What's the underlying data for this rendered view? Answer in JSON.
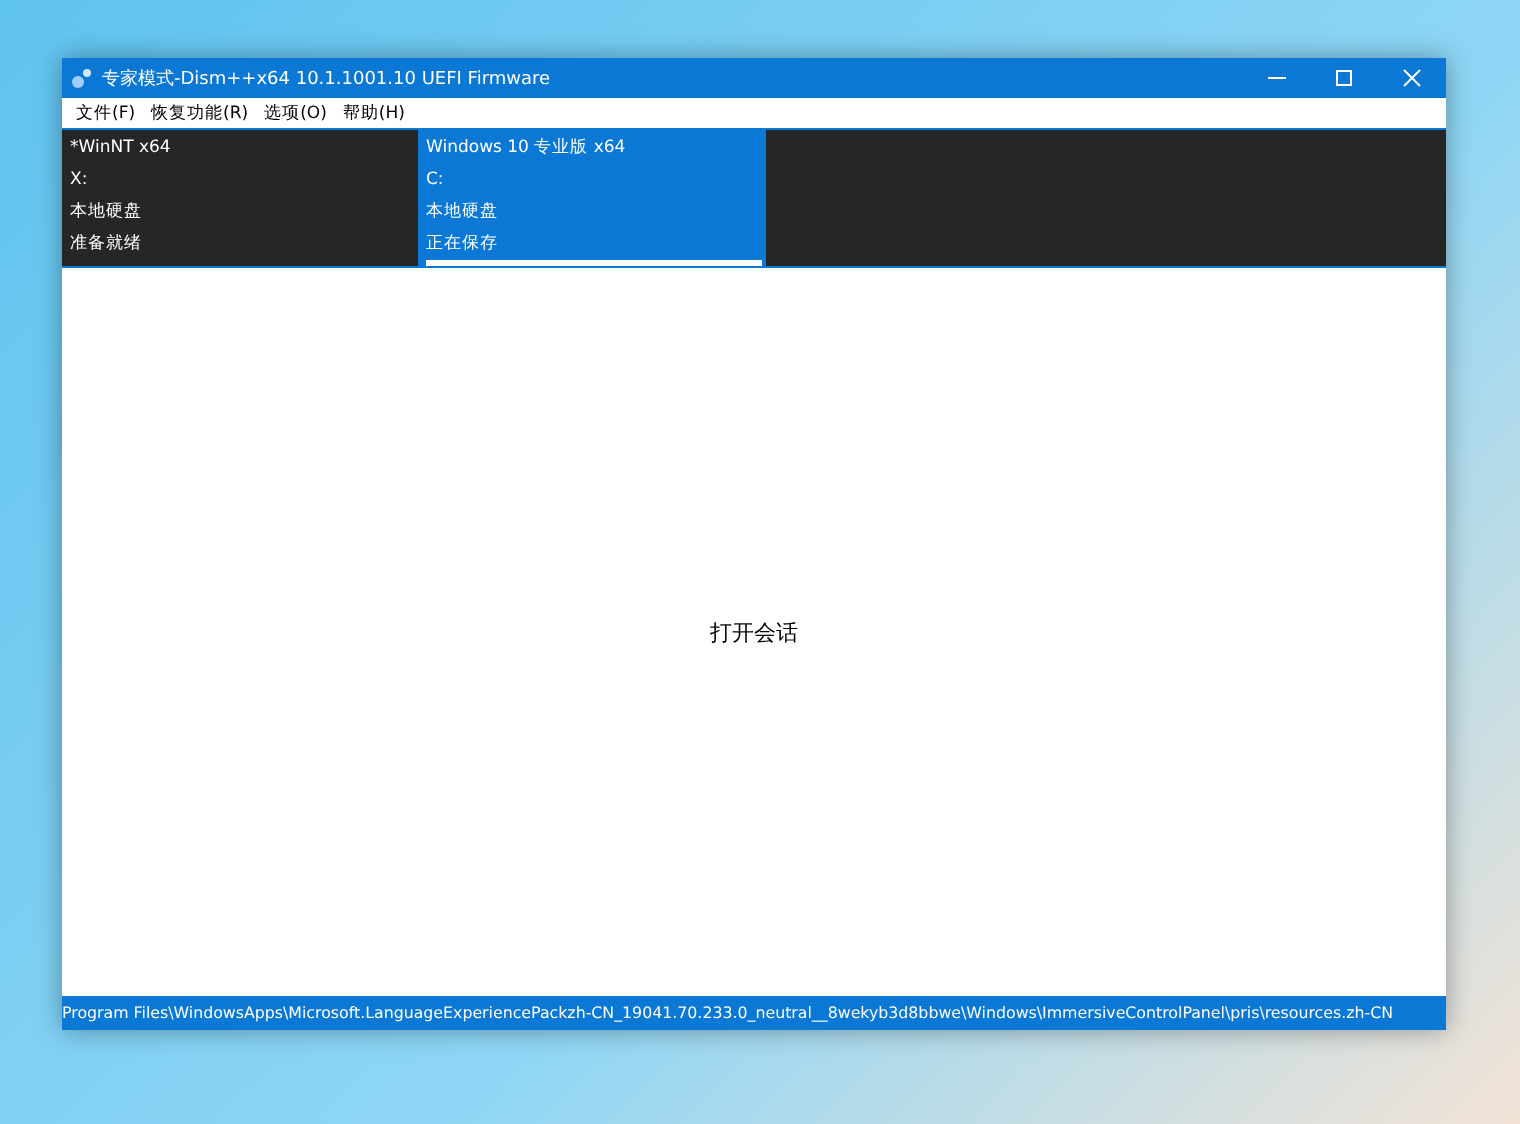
{
  "window": {
    "title": "专家模式-Dism++x64 10.1.1001.10 UEFI Firmware"
  },
  "menu": [
    {
      "label": "文件(F)"
    },
    {
      "label": "恢复功能(R)"
    },
    {
      "label": "选项(O)"
    },
    {
      "label": "帮助(H)"
    }
  ],
  "sessions": [
    {
      "name": "*WinNT x64",
      "drive": "X:",
      "disk": "本地硬盘",
      "status": "准备就绪",
      "selected": false
    },
    {
      "name": "Windows 10 专业版 x64",
      "drive": "C:",
      "disk": "本地硬盘",
      "status": "正在保存",
      "selected": true,
      "level": 1.0
    }
  ],
  "content": {
    "message": "打开会话"
  },
  "status_bar": {
    "text": "Program Files\\WindowsApps\\Microsoft.LanguageExperiencePackzh-CN_19041.70.233.0_neutral__8wekyb3d8bbwe\\Windows\\ImmersiveControlPanel\\pris\\resources.zh-CN"
  }
}
